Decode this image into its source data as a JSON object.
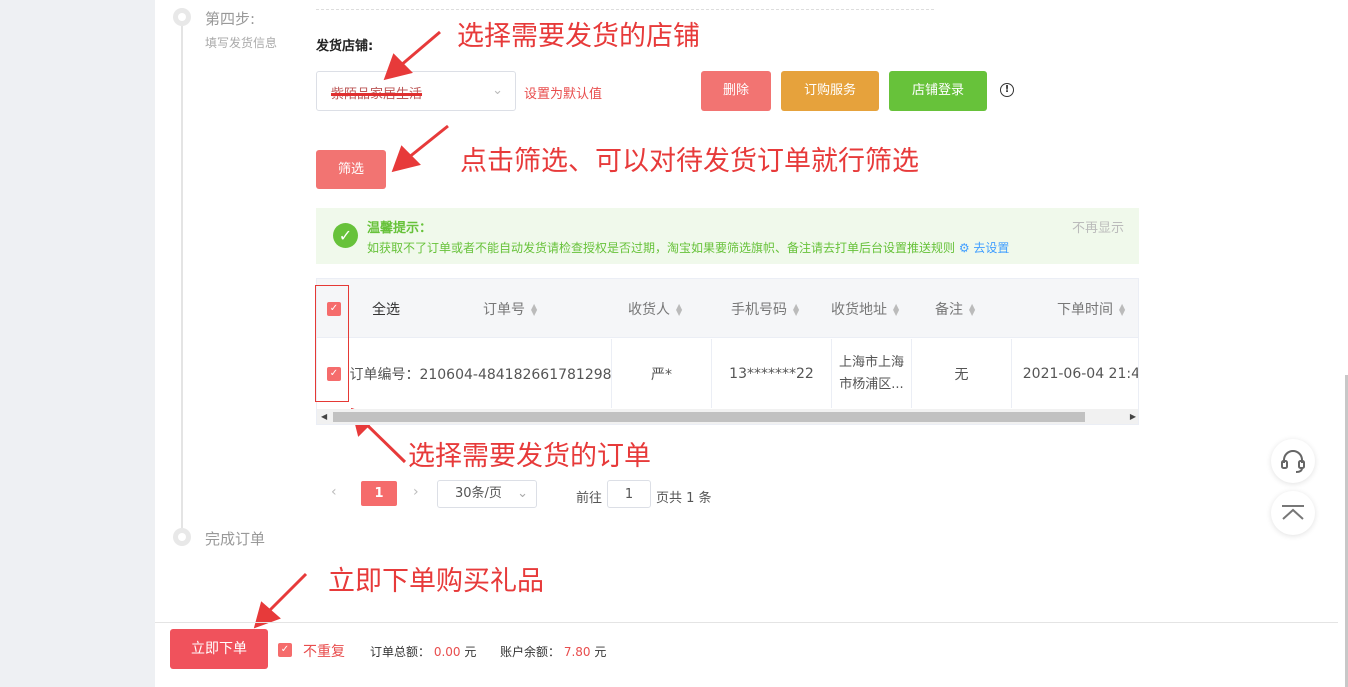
{
  "steps": {
    "step4_title": "第四步:",
    "step4_sub": "填写发货信息",
    "step5_title": "完成订单"
  },
  "store": {
    "label": "发货店铺:",
    "selected": "紫陌品家居生活",
    "set_default": "设置为默认值"
  },
  "buttons": {
    "delete": "删除",
    "order_service": "订购服务",
    "shop_login": "店铺登录",
    "filter": "筛选",
    "submit": "立即下单"
  },
  "annotations": {
    "a1": "选择需要发货的店铺",
    "a2": "点击筛选、可以对待发货订单就行筛选",
    "a3": "选择需要发货的订单",
    "a4": "立即下单购买礼品"
  },
  "tip": {
    "title": "温馨提示：",
    "body": "如获取不了订单或者不能自动发货请检查授权是否过期，淘宝如果要筛选旗帜、备注请去打单后台设置推送规则",
    "link": "去设置",
    "dismiss": "不再显示"
  },
  "table": {
    "headers": {
      "select_all": "全选",
      "order_no": "订单号",
      "receiver": "收货人",
      "phone": "手机号码",
      "address": "收货地址",
      "remark": "备注",
      "order_time": "下单时间"
    },
    "row": {
      "order_no": "订单编号：210604-484182661781298",
      "receiver": "严*",
      "phone": "13*******22",
      "address_line1": "上海市上海",
      "address_line2": "市杨浦区...",
      "remark": "无",
      "order_time": "2021-06-04 21:4"
    }
  },
  "pagination": {
    "current": "1",
    "page_size": "30条/页",
    "goto_label": "前往",
    "goto_value": "1",
    "total": "页共 1 条"
  },
  "footer": {
    "no_repeat": "不重复",
    "order_total_label": "订单总额：",
    "order_total_value": "0.00",
    "balance_label": "账户余额：",
    "balance_value": "7.80",
    "currency": "元"
  },
  "colors": {
    "primary_red": "#f27472",
    "orange": "#e6a23c",
    "green": "#67c23a",
    "annotation_red": "#e73a3a"
  }
}
